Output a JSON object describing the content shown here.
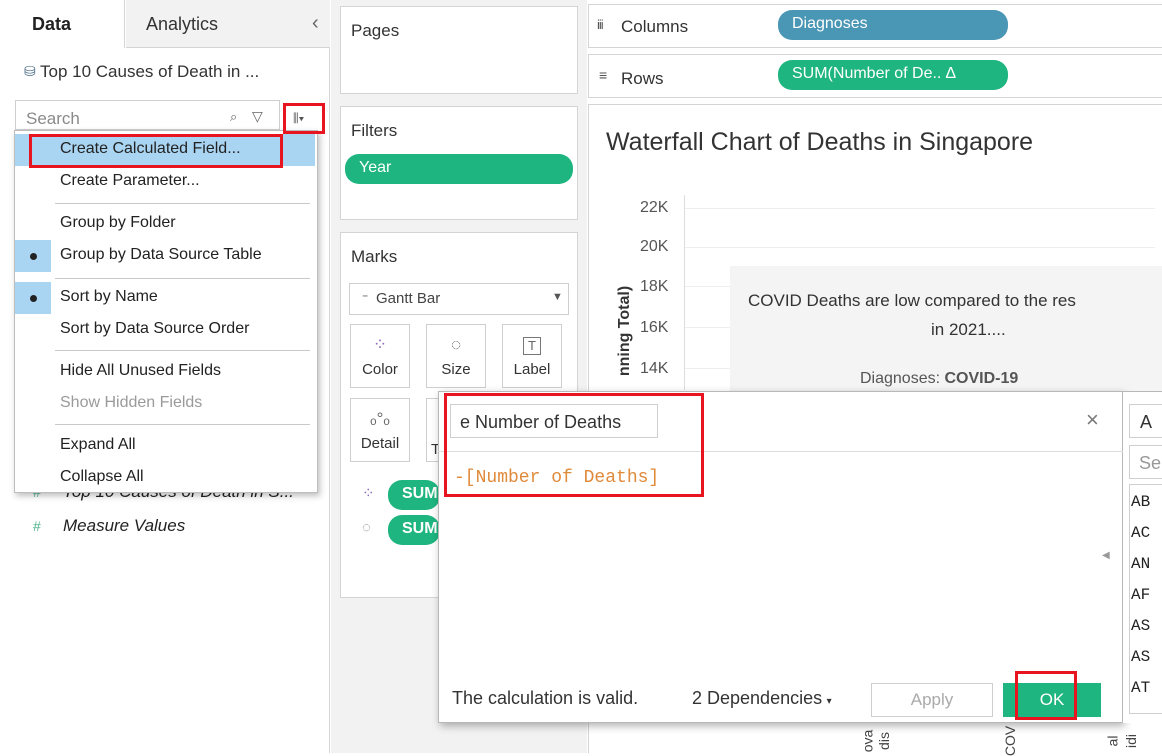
{
  "left_panel": {
    "tabs": [
      {
        "label": "Data"
      },
      {
        "label": "Analytics"
      }
    ],
    "collapse_glyph": "‹",
    "datasource": "Top 10 Causes of Death in ...",
    "search_placeholder": "Search",
    "fields": [
      {
        "icon": "#",
        "label": "Top 10 Causes of Death in S..."
      },
      {
        "icon": "#",
        "label": "Measure Values"
      }
    ]
  },
  "dropdown_menu": {
    "items": [
      {
        "label": "Create Calculated Field...",
        "highlighted": true
      },
      {
        "label": "Create Parameter..."
      },
      {
        "label": "Group by Folder"
      },
      {
        "label": "Group by Data Source Table",
        "checked": true
      },
      {
        "label": "Sort by Name",
        "checked": true
      },
      {
        "label": "Sort by Data Source Order"
      },
      {
        "label": "Hide All Unused Fields"
      },
      {
        "label": "Show Hidden Fields",
        "disabled": true
      },
      {
        "label": "Expand All"
      },
      {
        "label": "Collapse All"
      }
    ]
  },
  "cards": {
    "pages_label": "Pages",
    "filters_label": "Filters",
    "filter_pill": "Year",
    "marks_label": "Marks",
    "mark_type": "Gantt Bar",
    "mark_buttons": [
      {
        "label": "Color"
      },
      {
        "label": "Size"
      },
      {
        "label": "Label"
      },
      {
        "label": "Detail"
      },
      {
        "label": "T"
      }
    ],
    "mark_pills": [
      {
        "label": "SUM"
      },
      {
        "label": "SUM"
      }
    ]
  },
  "shelves": {
    "columns_label": "Columns",
    "columns_pill": "Diagnoses",
    "rows_label": "Rows",
    "rows_pill": "SUM(Number of De.. ∆"
  },
  "view": {
    "title": "Waterfall Chart of Deaths in Singapore",
    "ylabel": "nning Total)",
    "ticks": [
      "22K",
      "20K",
      "18K",
      "16K",
      "14K"
    ],
    "annotation_line1": "COVID Deaths are low compared to the res",
    "annotation_line2": "in 2021....",
    "annotation_field": "Diagnoses: ",
    "annotation_value": "COVID-19",
    "bottom_labels": [
      "C",
      "ova",
      "dis",
      "COV",
      "al",
      "idi"
    ]
  },
  "calc_dialog": {
    "name_value": "e Number of Deaths",
    "formula": "-[Number of Deaths]",
    "status": "The calculation is valid.",
    "dependencies": "2 Dependencies",
    "apply_label": "Apply",
    "ok_label": "OK",
    "close_glyph": "×"
  },
  "function_panel": {
    "dropdown_value": "A",
    "search_placeholder": "Se",
    "items": [
      "AB",
      "AC",
      "AN",
      "AF",
      "AS",
      "AS",
      "AT"
    ]
  }
}
